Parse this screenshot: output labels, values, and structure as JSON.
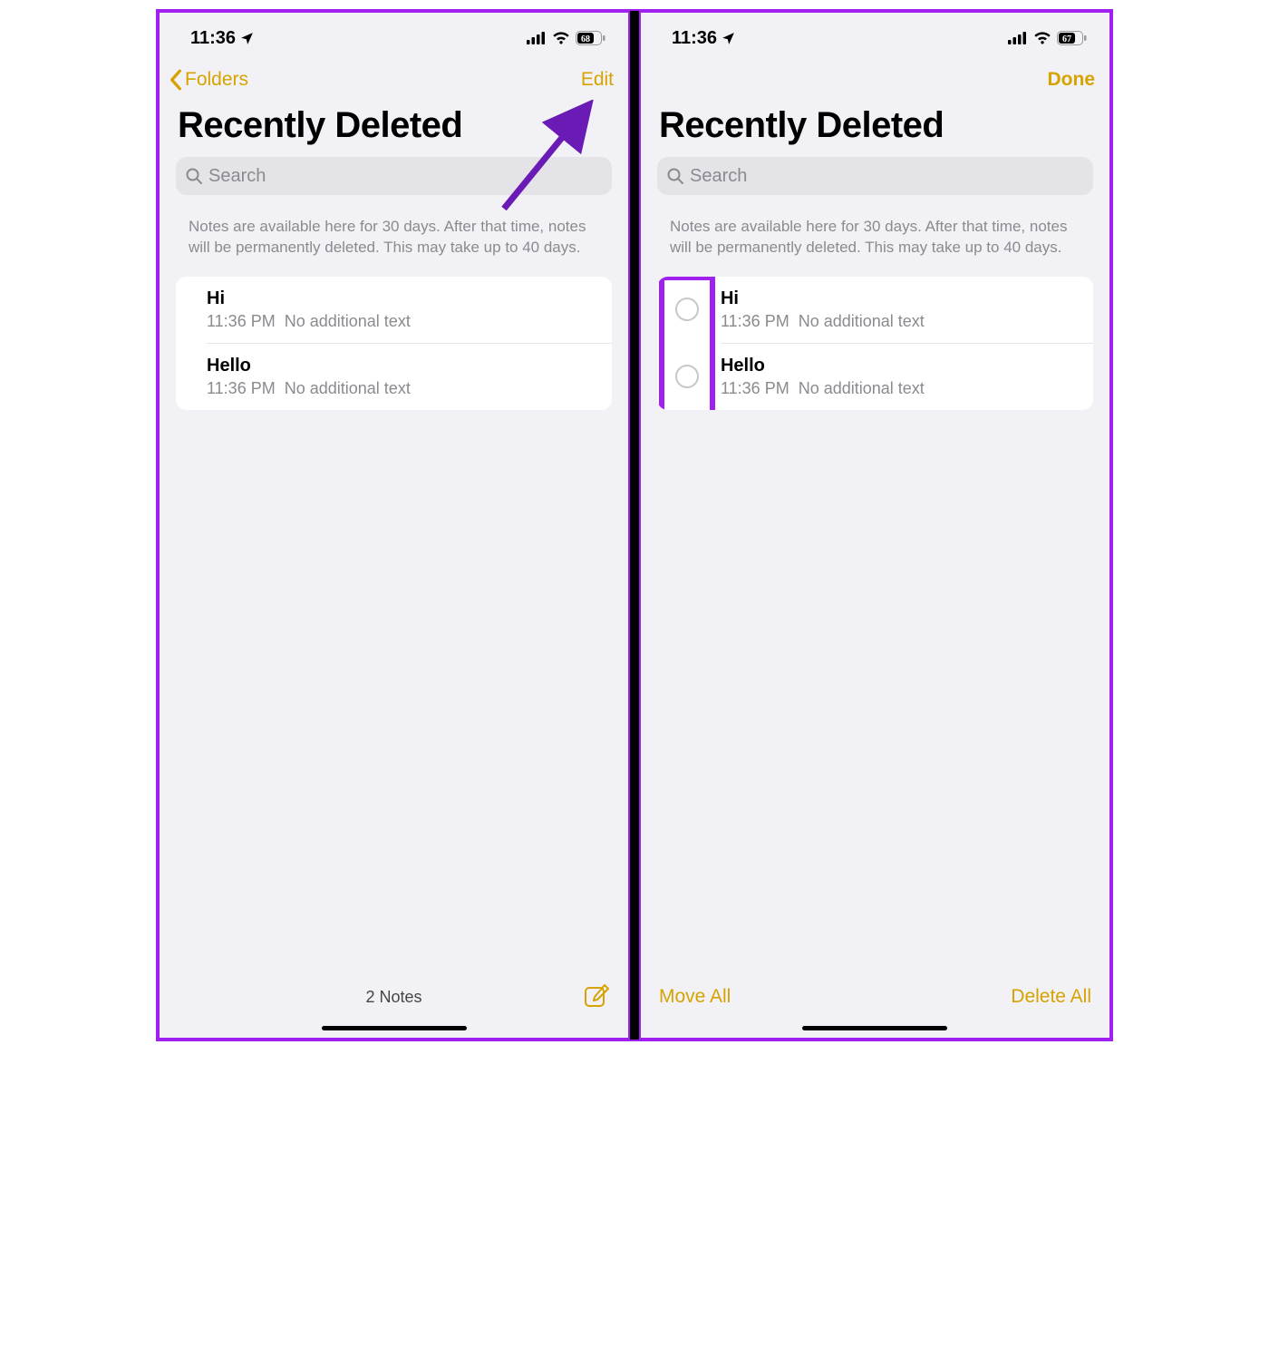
{
  "left": {
    "status": {
      "time": "11:36",
      "battery": "68"
    },
    "nav": {
      "back": "Folders",
      "right": "Edit"
    },
    "title": "Recently Deleted",
    "search_placeholder": "Search",
    "info": "Notes are available here for 30 days. After that time, notes will be permanently deleted. This may take up to 40 days.",
    "notes": [
      {
        "title": "Hi",
        "time": "11:36 PM",
        "sub": "No additional text"
      },
      {
        "title": "Hello",
        "time": "11:36 PM",
        "sub": "No additional text"
      }
    ],
    "footer_count": "2 Notes"
  },
  "right": {
    "status": {
      "time": "11:36",
      "battery": "67"
    },
    "nav": {
      "right": "Done"
    },
    "title": "Recently Deleted",
    "search_placeholder": "Search",
    "info": "Notes are available here for 30 days. After that time, notes will be permanently deleted. This may take up to 40 days.",
    "notes": [
      {
        "title": "Hi",
        "time": "11:36 PM",
        "sub": "No additional text"
      },
      {
        "title": "Hello",
        "time": "11:36 PM",
        "sub": "No additional text"
      }
    ],
    "footer": {
      "left": "Move All",
      "right": "Delete All"
    }
  }
}
